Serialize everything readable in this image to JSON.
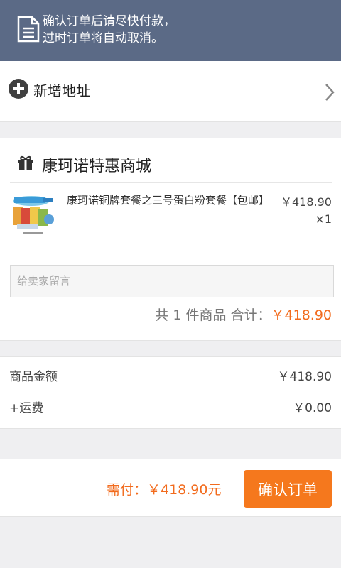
{
  "notice": {
    "line1": "确认订单后请尽快付款，",
    "line2": "过时订单将自动取消。",
    "icon": "document-icon"
  },
  "address": {
    "label": "新增地址",
    "icon": "plus-circle-icon"
  },
  "shop": {
    "name": "康珂诺特惠商城",
    "icon": "gift-icon",
    "product": {
      "title": "康珂诺铜牌套餐之三号蛋白粉套餐【包邮】",
      "price": "￥418.90",
      "qty": "×1"
    },
    "message_placeholder": "给卖家留言",
    "summary_prefix": "共 1 件商品 合计：",
    "summary_total": "￥418.90"
  },
  "fees": {
    "goods_label": "商品金额",
    "goods_value": "￥418.90",
    "shipping_label": "+运费",
    "shipping_value": "￥0.00"
  },
  "footer": {
    "payable": "需付：￥418.90元",
    "confirm_label": "确认订单"
  },
  "colors": {
    "accent": "#f5781d",
    "notice_bg": "#5b6a86"
  }
}
